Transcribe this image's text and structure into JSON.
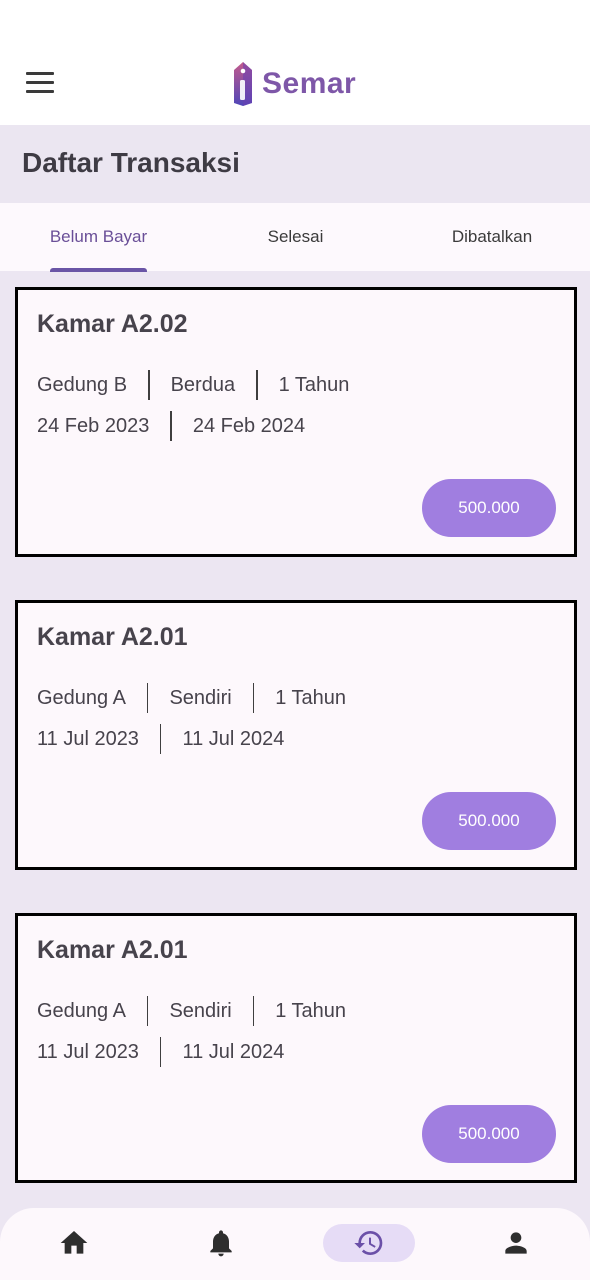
{
  "app": {
    "name": "Semar"
  },
  "page": {
    "title": "Daftar Transaksi"
  },
  "tabs": [
    {
      "label": "Belum Bayar",
      "active": true
    },
    {
      "label": "Selesai",
      "active": false
    },
    {
      "label": "Dibatalkan",
      "active": false
    }
  ],
  "transactions": [
    {
      "room": "Kamar A2.02",
      "building": "Gedung B",
      "occupancy": "Berdua",
      "duration": "1 Tahun",
      "start_date": "24 Feb 2023",
      "end_date": "24 Feb 2024",
      "price": "500.000"
    },
    {
      "room": "Kamar A2.01",
      "building": "Gedung A",
      "occupancy": "Sendiri",
      "duration": "1 Tahun",
      "start_date": "11 Jul 2023",
      "end_date": "11 Jul 2024",
      "price": "500.000"
    },
    {
      "room": "Kamar A2.01",
      "building": "Gedung A",
      "occupancy": "Sendiri",
      "duration": "1 Tahun",
      "start_date": "11 Jul 2023",
      "end_date": "11 Jul 2024",
      "price": "500.000"
    }
  ],
  "bottom_nav": [
    {
      "icon": "home-icon",
      "active": false
    },
    {
      "icon": "bell-icon",
      "active": false
    },
    {
      "icon": "history-icon",
      "active": true
    },
    {
      "icon": "person-icon",
      "active": false
    }
  ],
  "colors": {
    "brand": "#7e57a8",
    "accent": "#a07ee0",
    "tab_indicator": "#6a55a6",
    "background": "#ece6f2"
  }
}
